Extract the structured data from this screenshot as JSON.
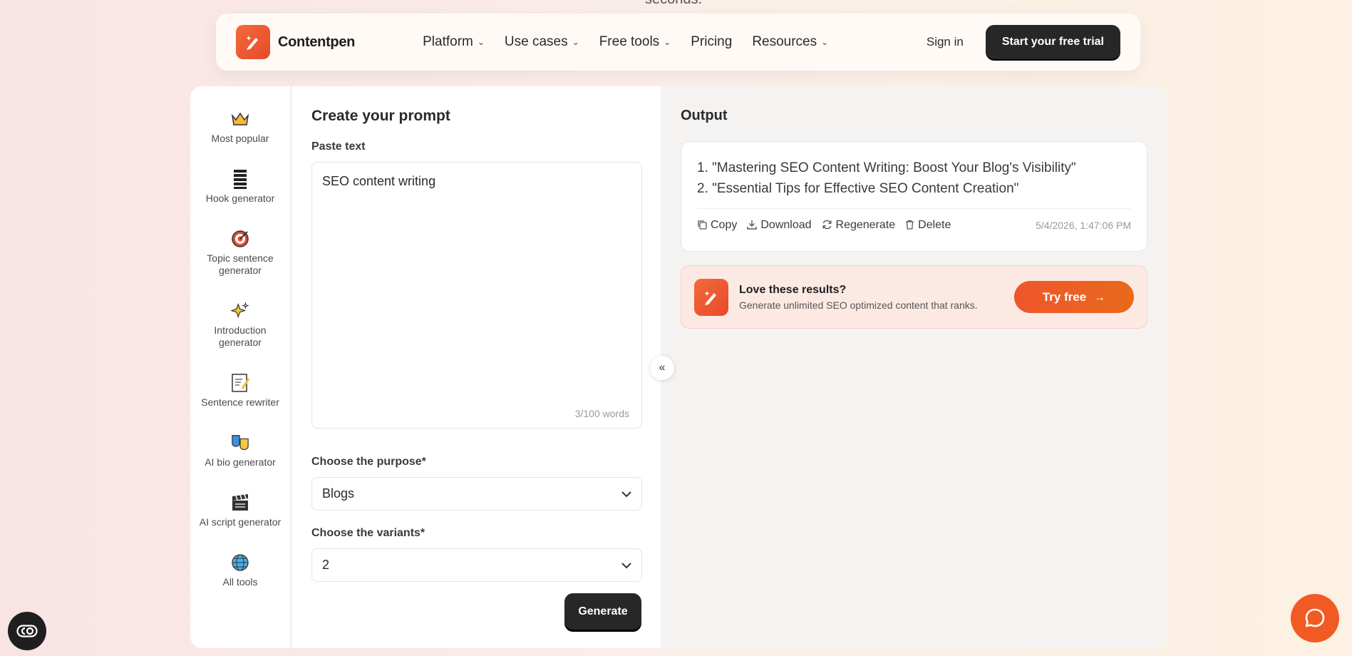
{
  "top_peek": "seconds.",
  "brand": {
    "name": "Contentpen",
    "accent": "#f26a3b"
  },
  "nav": {
    "items": [
      {
        "label": "Platform",
        "has_dropdown": true
      },
      {
        "label": "Use cases",
        "has_dropdown": true
      },
      {
        "label": "Free tools",
        "has_dropdown": true
      },
      {
        "label": "Pricing",
        "has_dropdown": false
      },
      {
        "label": "Resources",
        "has_dropdown": true
      }
    ],
    "signin": "Sign in",
    "cta": "Start your free trial"
  },
  "sidebar": {
    "items": [
      {
        "label": "Most popular",
        "icon": "crown-icon"
      },
      {
        "label": "Hook generator",
        "icon": "stack-icon"
      },
      {
        "label": "Topic sentence generator",
        "icon": "target-icon"
      },
      {
        "label": "Introduction generator",
        "icon": "sparkles-icon"
      },
      {
        "label": "Sentence rewriter",
        "icon": "memo-icon"
      },
      {
        "label": "AI bio generator",
        "icon": "masks-icon"
      },
      {
        "label": "AI script generator",
        "icon": "clapper-icon"
      },
      {
        "label": "All tools",
        "icon": "globe-icon"
      }
    ]
  },
  "prompt": {
    "title": "Create your prompt",
    "paste_label": "Paste text",
    "text_value": "SEO content writing",
    "word_count": "3/100 words",
    "purpose_label": "Choose the purpose*",
    "purpose_value": "Blogs",
    "variants_label": "Choose the variants*",
    "variants_value": "2",
    "generate": "Generate"
  },
  "collapse_glyph": "«",
  "output": {
    "title": "Output",
    "results": [
      "1. \"Mastering SEO Content Writing: Boost Your Blog's Visibility\"",
      "2. \"Essential Tips for Effective SEO Content Creation\""
    ],
    "actions": {
      "copy": "Copy",
      "download": "Download",
      "regenerate": "Regenerate",
      "delete": "Delete"
    },
    "timestamp": "5/4/2026, 1:47:06 PM",
    "promo": {
      "title": "Love these results?",
      "subtitle": "Generate unlimited SEO optimized content that ranks.",
      "cta": "Try free",
      "cta_arrow": "→"
    }
  }
}
